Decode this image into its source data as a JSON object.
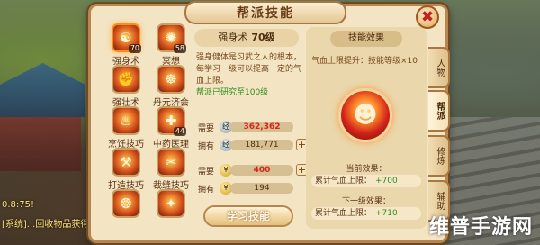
{
  "window": {
    "title": "帮派技能",
    "close_label": "✖"
  },
  "chat": {
    "line1": "0.8:75!",
    "line2": "[系统]...回收物品获得..."
  },
  "skills": [
    {
      "name": "强身术",
      "level": "70",
      "glyph": "☯",
      "active": true
    },
    {
      "name": "冥想",
      "level": "58",
      "glyph": "✺"
    },
    {
      "name": "强壮术",
      "level": "",
      "glyph": "✊"
    },
    {
      "name": "丹元济会",
      "level": "",
      "glyph": "☸"
    },
    {
      "name": "烹饪技巧",
      "level": "",
      "glyph": "♨"
    },
    {
      "name": "中药医理",
      "level": "44",
      "glyph": "✚"
    },
    {
      "name": "打造技巧",
      "level": "",
      "glyph": "⚒"
    },
    {
      "name": "裁缝技巧",
      "level": "",
      "glyph": "✂"
    },
    {
      "name": "",
      "level": "",
      "glyph": "❂"
    },
    {
      "name": "",
      "level": "",
      "glyph": "✦"
    }
  ],
  "detail": {
    "skill_name": "强身术",
    "skill_level": "70级",
    "description": "强身健体是习武之人的根本，每学习一级可以提高一定的气血上限。",
    "research_note": "帮派已研究至100级",
    "cost_label_need": "需要",
    "cost_label_have": "拥有",
    "exp_need": "362,362",
    "exp_have": "181,771",
    "gold_need": "400",
    "gold_have": "194",
    "learn_button": "学习技能"
  },
  "effect": {
    "title": "技能效果",
    "desc": "气血上限提升：技能等级×10",
    "current_label": "当前效果：",
    "current_line": "累计气血上限：",
    "current_value": "+700",
    "next_label": "下一级效果：",
    "next_line": "累计气血上限：",
    "next_value": "+710"
  },
  "side_tabs": [
    {
      "label": "人物",
      "active": false
    },
    {
      "label": "帮派",
      "active": true
    },
    {
      "label": "修炼",
      "active": false
    },
    {
      "label": "辅助",
      "active": false
    }
  ],
  "watermark": "维普手游网"
}
